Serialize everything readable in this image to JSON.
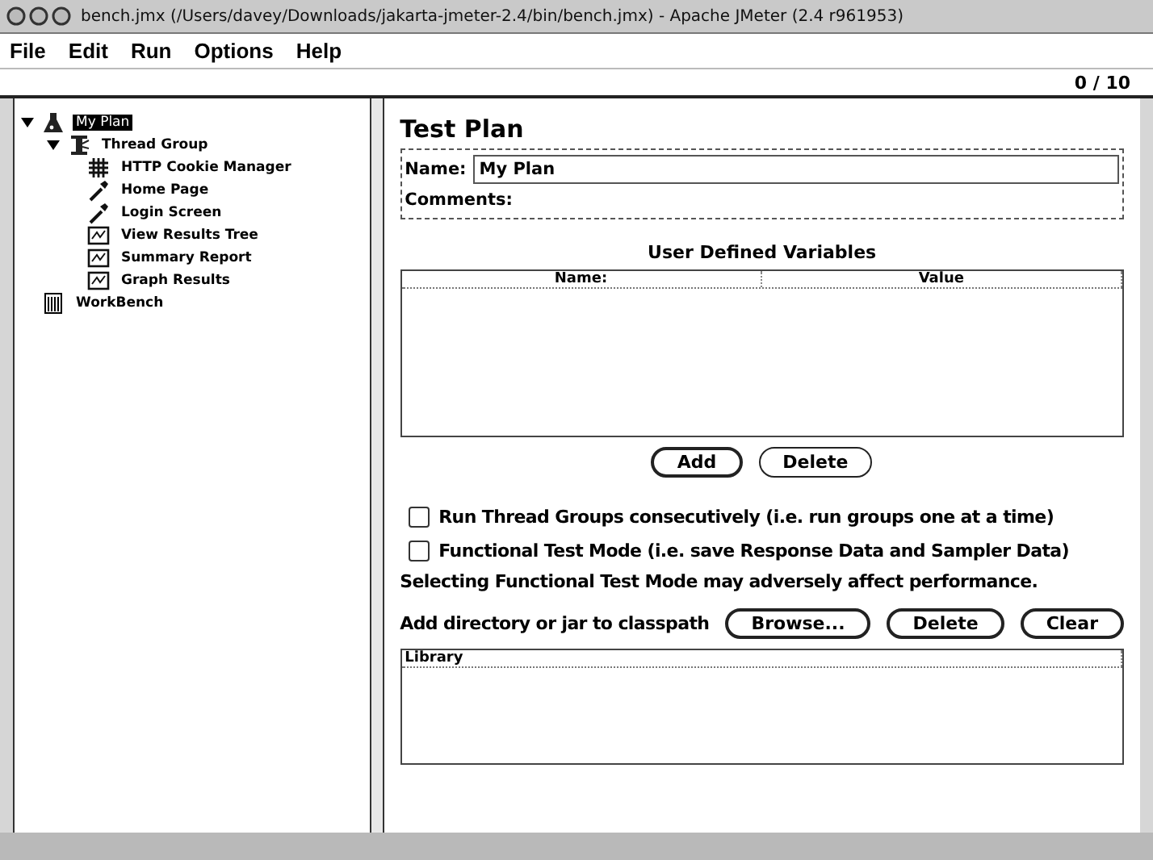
{
  "window": {
    "title": "bench.jmx (/Users/davey/Downloads/jakarta-jmeter-2.4/bin/bench.jmx) - Apache JMeter (2.4 r961953)"
  },
  "menu": [
    "File",
    "Edit",
    "Run",
    "Options",
    "Help"
  ],
  "toolbar": {
    "counter": "0 / 10"
  },
  "tree": [
    {
      "label": "My Plan",
      "kind": "plan",
      "selected": true,
      "expanded": true,
      "children": [
        {
          "label": "Thread Group",
          "kind": "threads",
          "selected": false,
          "expanded": true,
          "children": [
            {
              "label": "HTTP Cookie Manager",
              "kind": "config",
              "selected": false
            },
            {
              "label": "Home Page",
              "kind": "sampler",
              "selected": false
            },
            {
              "label": "Login Screen",
              "kind": "sampler",
              "selected": false
            },
            {
              "label": "View Results Tree",
              "kind": "listener",
              "selected": false
            },
            {
              "label": "Summary Report",
              "kind": "listener",
              "selected": false
            },
            {
              "label": "Graph Results",
              "kind": "listener",
              "selected": false
            }
          ]
        }
      ]
    },
    {
      "label": "WorkBench",
      "kind": "workbench",
      "selected": false
    }
  ],
  "panel": {
    "title": "Test Plan",
    "name_label": "Name:",
    "name_value": "My Plan",
    "comments_label": "Comments:",
    "variables": {
      "title": "User Defined Variables",
      "columns": [
        "Name:",
        "Value"
      ]
    },
    "variable_buttons": [
      "Add",
      "Delete"
    ],
    "checkboxes": [
      {
        "label": "Run Thread Groups consecutively (i.e. run groups one at a time)",
        "checked": false
      },
      {
        "label": "Functional Test Mode (i.e. save Response Data and Sampler Data)",
        "checked": false
      }
    ],
    "note": "Selecting Functional Test Mode may adversely affect performance.",
    "classpath_label": "Add directory or jar to classpath",
    "classpath_buttons": [
      "Browse...",
      "Delete",
      "Clear"
    ],
    "library": {
      "columns": [
        "Library"
      ]
    }
  }
}
